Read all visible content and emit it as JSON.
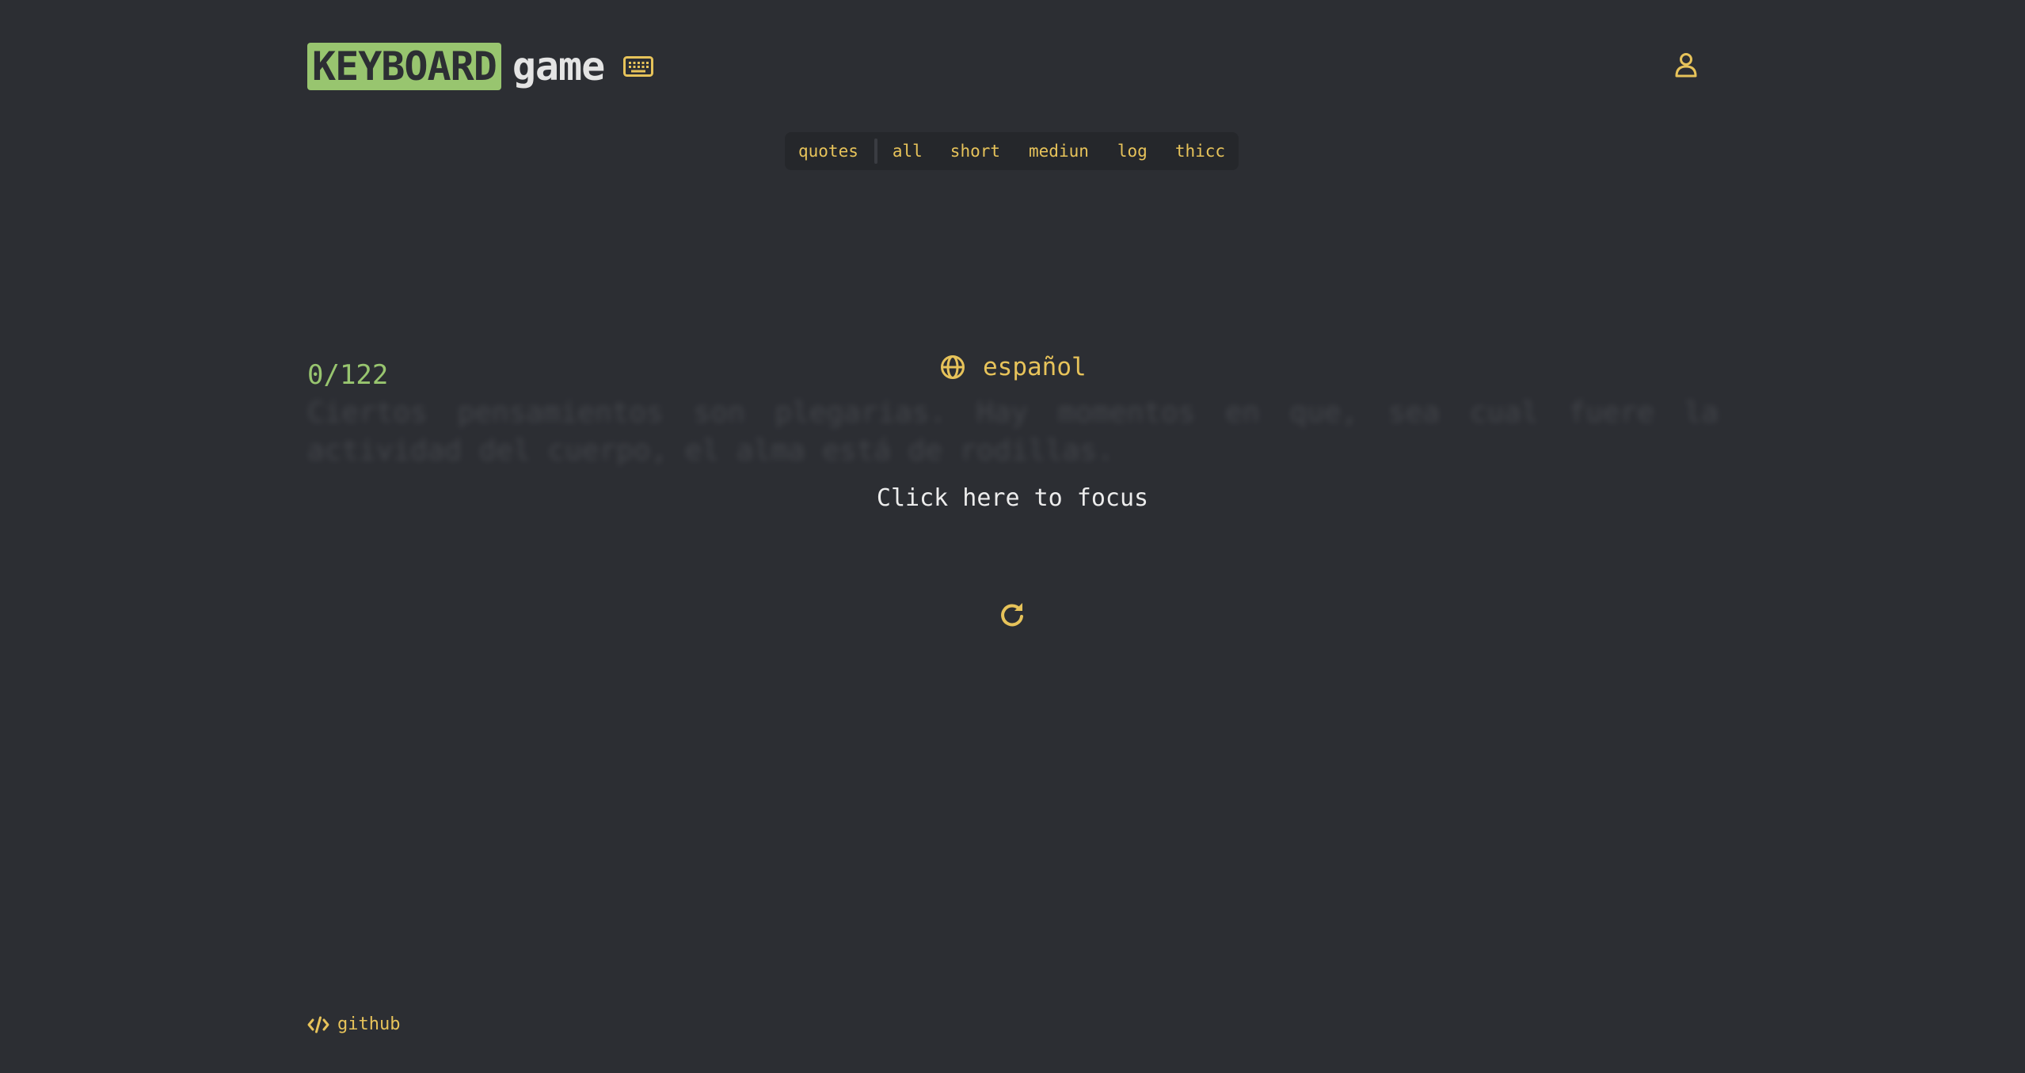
{
  "header": {
    "logo_highlight": "KEYBOARD",
    "logo_text": "game",
    "keyboard_icon": "keyboard-icon",
    "user_icon": "user-icon"
  },
  "modes": {
    "items": [
      "quotes",
      "all",
      "short",
      "mediun",
      "log",
      "thicc"
    ]
  },
  "language": {
    "icon": "globe-icon",
    "label": "español"
  },
  "test": {
    "counter": "0/122",
    "quote": "Ciertos pensamientos son plegarias. Hay momentos en que, sea cual fuere la actividad del cuerpo, el alma está de rodillas.",
    "focus_hint": "Click here to focus",
    "restart_icon": "restart-icon"
  },
  "footer": {
    "icon": "code-icon",
    "github_label": "github"
  },
  "colors": {
    "background": "#2c2e33",
    "accent": "#e7c35a",
    "green": "#98c56f",
    "text": "#e4e4e4"
  }
}
